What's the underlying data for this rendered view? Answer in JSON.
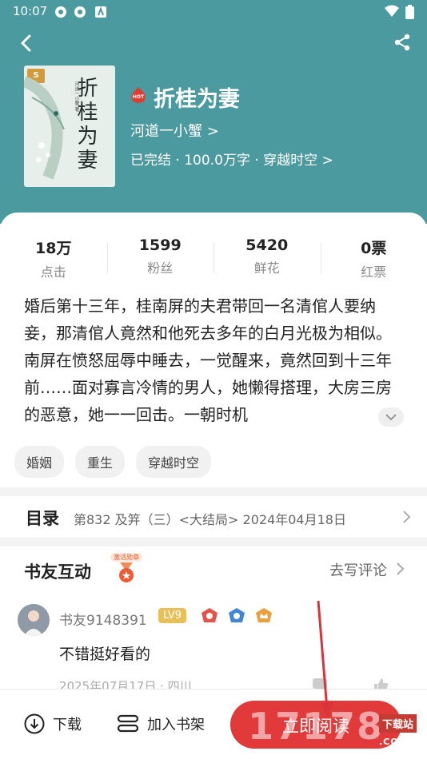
{
  "status_bar": {
    "time": "10:07"
  },
  "book": {
    "title": "折桂为妻",
    "author": "河道一小蟹 >",
    "meta": "已完结 · 100.0万字 · 穿越时空 >",
    "cover_title": "折桂为妻",
    "cover_subtitle": "河道一小蟹 著",
    "cover_badge": "S",
    "hot_label": "HOT"
  },
  "stats": [
    {
      "value": "18万",
      "label": "点击"
    },
    {
      "value": "1599",
      "label": "粉丝"
    },
    {
      "value": "5420",
      "label": "鲜花"
    },
    {
      "value": "0票",
      "label": "红票"
    }
  ],
  "description": "婚后第十三年，桂南屏的夫君带回一名清倌人要纳妾，那清倌人竟然和他死去多年的白月光极为相似。南屏在愤怒屈辱中睡去，一觉醒来，竟然回到十三年前……面对寡言冷情的男人，她懒得搭理，大房三房的恶意，她一一回击。一朝时机",
  "tags": [
    "婚姻",
    "重生",
    "穿越时空"
  ],
  "catalog": {
    "heading": "目录",
    "latest": "第832 及笄（三）<大结局>  2024年04月18日"
  },
  "interaction": {
    "heading": "书友互动",
    "medal_text": "激活勋章",
    "write_label": "去写评论",
    "comment": {
      "user": "书友9148391",
      "level": "LV9",
      "text": "不错挺好看的",
      "date": "2025年07月17日 · 四川"
    }
  },
  "bottom_bar": {
    "download_label": "下载",
    "shelf_label": "加入书架",
    "read_label": "立即阅读"
  },
  "watermark": {
    "main": "17178",
    "tag": "下载站",
    "domain": ".COM"
  },
  "colors": {
    "header_bg": "#4a9a9f",
    "read_button": "#e2393a",
    "level_badge": "#e8c05a",
    "annotation_arrow": "#d8343a"
  }
}
